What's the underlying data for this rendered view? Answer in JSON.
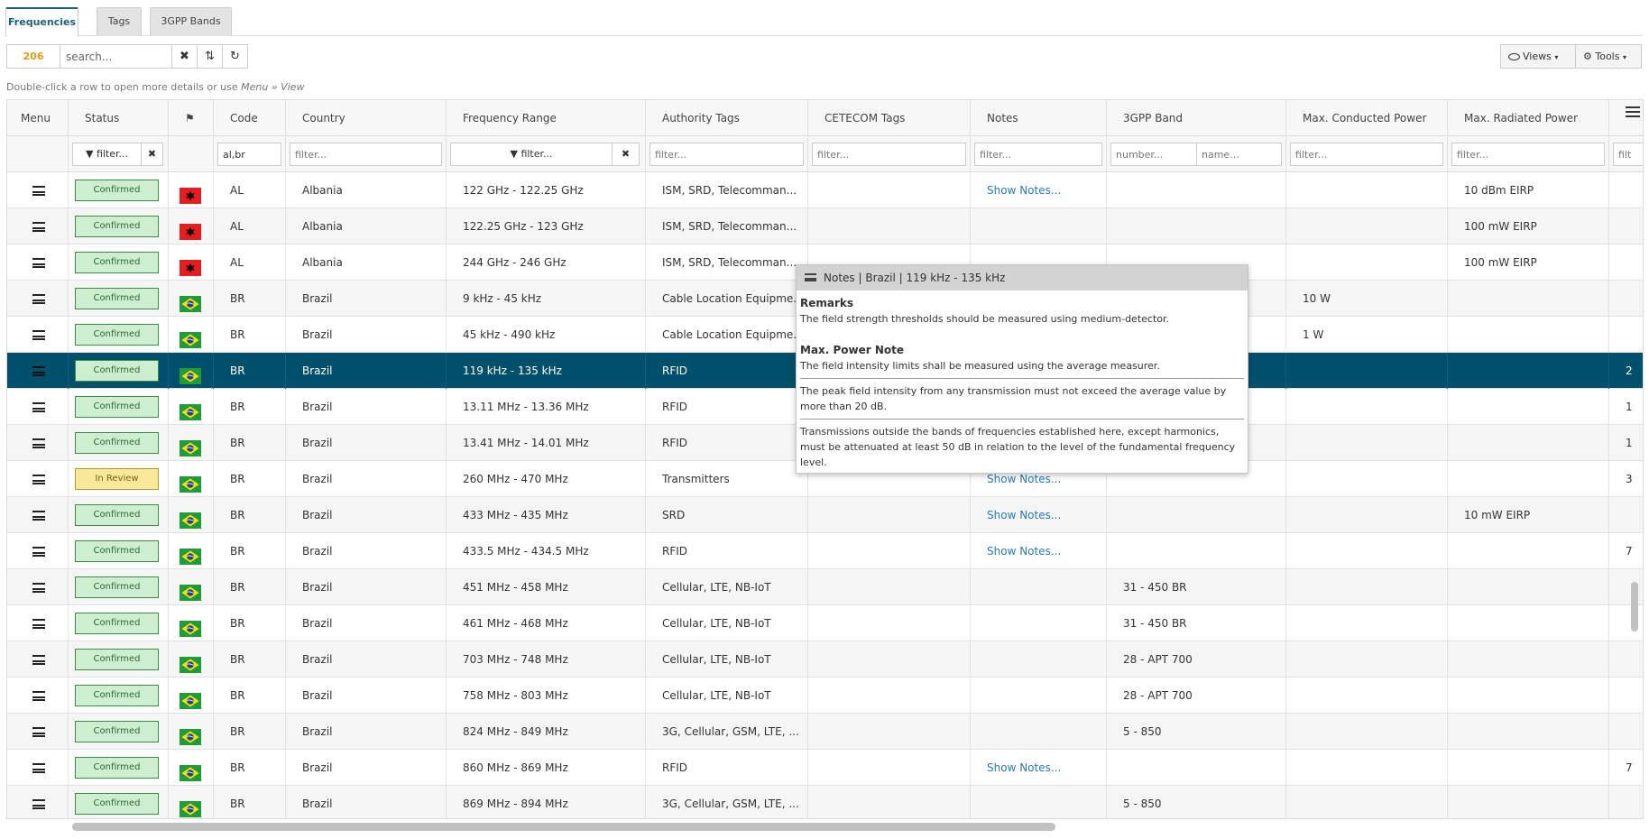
{
  "tabs": [
    "Frequencies",
    "Tags",
    "3GPP Bands"
  ],
  "toolbar": {
    "count": "206",
    "search_placeholder": "search...",
    "clear_icon": "✖",
    "sort_icon": "⇅",
    "refresh_icon": "↻",
    "views_label": "Views",
    "tools_label": "Tools"
  },
  "hint": {
    "prefix": "Double-click a row to open more details or use ",
    "path": "Menu » View"
  },
  "columns": {
    "menu": "Menu",
    "status": "Status",
    "code": "Code",
    "country": "Country",
    "frequency_range": "Frequency Range",
    "authority_tags": "Authority Tags",
    "cetecom_tags": "CETECOM Tags",
    "notes": "Notes",
    "band_3gpp": "3GPP Band",
    "max_conducted": "Max. Conducted Power",
    "max_radiated": "Max. Radiated Power"
  },
  "filters": {
    "status": "filter...",
    "code_value": "al,br",
    "country": "filter...",
    "frequency_range": "filter...",
    "authority_tags": "filter...",
    "cetecom_tags": "filter...",
    "notes": "filter...",
    "band_number": "number...",
    "band_name": "name...",
    "max_conducted": "filter...",
    "max_radiated": "filter...",
    "last": "filt"
  },
  "rows": [
    {
      "status": "Confirmed",
      "flag": "AL",
      "code": "AL",
      "country": "Albania",
      "range": "122 GHz - 122.25 GHz",
      "auth": "ISM, SRD, Telecomman...",
      "cetecom": "",
      "notes": "Show Notes...",
      "band": "",
      "cond": "",
      "rad": "10 dBm EIRP",
      "extra": ""
    },
    {
      "status": "Confirmed",
      "flag": "AL",
      "code": "AL",
      "country": "Albania",
      "range": "122.25 GHz - 123 GHz",
      "auth": "ISM, SRD, Telecomman...",
      "cetecom": "",
      "notes": "",
      "band": "",
      "cond": "",
      "rad": "100 mW EIRP",
      "extra": ""
    },
    {
      "status": "Confirmed",
      "flag": "AL",
      "code": "AL",
      "country": "Albania",
      "range": "244 GHz - 246 GHz",
      "auth": "ISM, SRD, Telecomman...",
      "cetecom": "",
      "notes": "",
      "band": "",
      "cond": "",
      "rad": "100 mW EIRP",
      "extra": ""
    },
    {
      "status": "Confirmed",
      "flag": "BR",
      "code": "BR",
      "country": "Brazil",
      "range": "9 kHz - 45 kHz",
      "auth": "Cable Location Equipme...",
      "cetecom": "",
      "notes": "",
      "band": "",
      "cond": "10 W",
      "rad": "",
      "extra": ""
    },
    {
      "status": "Confirmed",
      "flag": "BR",
      "code": "BR",
      "country": "Brazil",
      "range": "45 kHz - 490 kHz",
      "auth": "Cable Location Equipme...",
      "cetecom": "",
      "notes": "",
      "band": "",
      "cond": "1 W",
      "rad": "",
      "extra": ""
    },
    {
      "status": "Confirmed",
      "flag": "BR",
      "code": "BR",
      "country": "Brazil",
      "range": "119 kHz - 135 kHz",
      "auth": "RFID",
      "cetecom": "",
      "notes": "",
      "band": "",
      "cond": "",
      "rad": "",
      "extra": "2"
    },
    {
      "status": "Confirmed",
      "flag": "BR",
      "code": "BR",
      "country": "Brazil",
      "range": "13.11 MHz - 13.36 MHz",
      "auth": "RFID",
      "cetecom": "",
      "notes": "",
      "band": "",
      "cond": "",
      "rad": "",
      "extra": "1"
    },
    {
      "status": "Confirmed",
      "flag": "BR",
      "code": "BR",
      "country": "Brazil",
      "range": "13.41 MHz - 14.01 MHz",
      "auth": "RFID",
      "cetecom": "",
      "notes": "",
      "band": "",
      "cond": "",
      "rad": "",
      "extra": "1"
    },
    {
      "status": "In Review",
      "flag": "BR",
      "code": "BR",
      "country": "Brazil",
      "range": "260 MHz - 470 MHz",
      "auth": "Transmitters",
      "cetecom": "",
      "notes": "Show Notes...",
      "band": "",
      "cond": "",
      "rad": "",
      "extra": "3"
    },
    {
      "status": "Confirmed",
      "flag": "BR",
      "code": "BR",
      "country": "Brazil",
      "range": "433 MHz - 435 MHz",
      "auth": "SRD",
      "cetecom": "",
      "notes": "Show Notes...",
      "band": "",
      "cond": "",
      "rad": "10 mW EIRP",
      "extra": ""
    },
    {
      "status": "Confirmed",
      "flag": "BR",
      "code": "BR",
      "country": "Brazil",
      "range": "433.5 MHz - 434.5 MHz",
      "auth": "RFID",
      "cetecom": "",
      "notes": "Show Notes...",
      "band": "",
      "cond": "",
      "rad": "",
      "extra": "7"
    },
    {
      "status": "Confirmed",
      "flag": "BR",
      "code": "BR",
      "country": "Brazil",
      "range": "451 MHz - 458 MHz",
      "auth": "Cellular, LTE, NB-IoT",
      "cetecom": "",
      "notes": "",
      "band": "31 - 450 BR",
      "cond": "",
      "rad": "",
      "extra": ""
    },
    {
      "status": "Confirmed",
      "flag": "BR",
      "code": "BR",
      "country": "Brazil",
      "range": "461 MHz - 468 MHz",
      "auth": "Cellular, LTE, NB-IoT",
      "cetecom": "",
      "notes": "",
      "band": "31 - 450 BR",
      "cond": "",
      "rad": "",
      "extra": ""
    },
    {
      "status": "Confirmed",
      "flag": "BR",
      "code": "BR",
      "country": "Brazil",
      "range": "703 MHz - 748 MHz",
      "auth": "Cellular, LTE, NB-IoT",
      "cetecom": "",
      "notes": "",
      "band": "28 - APT 700",
      "cond": "",
      "rad": "",
      "extra": ""
    },
    {
      "status": "Confirmed",
      "flag": "BR",
      "code": "BR",
      "country": "Brazil",
      "range": "758 MHz - 803 MHz",
      "auth": "Cellular, LTE, NB-IoT",
      "cetecom": "",
      "notes": "",
      "band": "28 - APT 700",
      "cond": "",
      "rad": "",
      "extra": ""
    },
    {
      "status": "Confirmed",
      "flag": "BR",
      "code": "BR",
      "country": "Brazil",
      "range": "824 MHz - 849 MHz",
      "auth": "3G, Cellular, GSM, LTE, ...",
      "cetecom": "",
      "notes": "",
      "band": "5 - 850",
      "cond": "",
      "rad": "",
      "extra": ""
    },
    {
      "status": "Confirmed",
      "flag": "BR",
      "code": "BR",
      "country": "Brazil",
      "range": "860 MHz - 869 MHz",
      "auth": "RFID",
      "cetecom": "",
      "notes": "Show Notes...",
      "band": "",
      "cond": "",
      "rad": "",
      "extra": "7"
    },
    {
      "status": "Confirmed",
      "flag": "BR",
      "code": "BR",
      "country": "Brazil",
      "range": "869 MHz - 894 MHz",
      "auth": "3G, Cellular, GSM, LTE, ...",
      "cetecom": "",
      "notes": "",
      "band": "5 - 850",
      "cond": "",
      "rad": "",
      "extra": ""
    }
  ],
  "selected_row": 5,
  "popup": {
    "title": "Notes | Brazil | 119 kHz - 135 kHz",
    "remarks_title": "Remarks",
    "remarks_text": "The field strength thresholds should be measured using medium-detector.",
    "maxpower_title": "Max. Power Note",
    "maxpower_text": "The field intensity limits shall be measured using the average measurer.",
    "para2": "The peak field intensity from any transmission must not exceed the average value by more than 20 dB.",
    "para3": "Transmissions outside the bands of frequencies established here, except harmonics, must be attenuated at least 50 dB in relation to the level of the fundamental frequency level."
  },
  "colors": {
    "accent": "#00506b",
    "confirmed_bg": "#cdeed0",
    "review_bg": "#f9e79a",
    "link": "#2a7ab8",
    "count": "#e09a1b"
  }
}
